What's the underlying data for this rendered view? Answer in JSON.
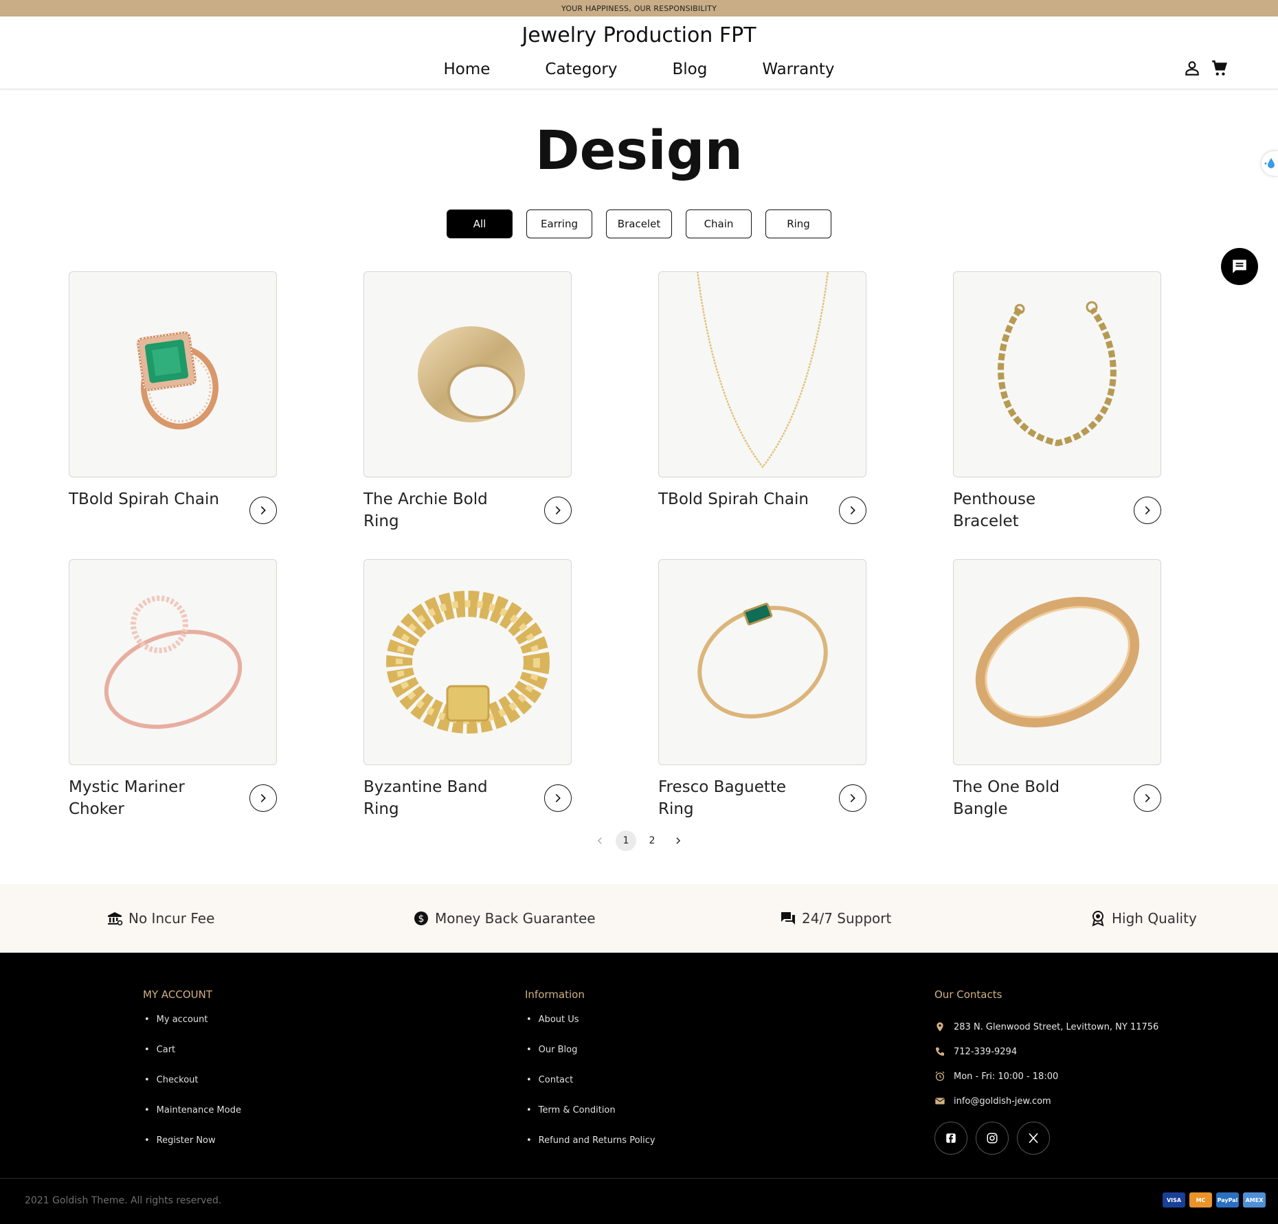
{
  "topbar": {
    "text": "YOUR HAPPINESS, OUR RESPONSIBILITY"
  },
  "header": {
    "brand": "Jewelry Production FPT",
    "nav": [
      "Home",
      "Category",
      "Blog",
      "Warranty"
    ],
    "icons": [
      "account-icon",
      "cart-icon"
    ]
  },
  "page": {
    "title": "Design"
  },
  "filters": [
    "All",
    "Earring",
    "Bracelet",
    "Chain",
    "Ring"
  ],
  "active_filter": "All",
  "products": [
    {
      "name": "TBold Spirah Chain",
      "image": "emerald-ring"
    },
    {
      "name": "The Archie Bold Ring",
      "image": "dome-ring"
    },
    {
      "name": "TBold Spirah Chain",
      "image": "chain-necklace"
    },
    {
      "name": "Penthouse Bracelet",
      "image": "chain-bracelet"
    },
    {
      "name": "Mystic Mariner Choker",
      "image": "circle-diamond-ring"
    },
    {
      "name": "Byzantine Band Ring",
      "image": "byzantine-ring"
    },
    {
      "name": "Fresco Baguette Ring",
      "image": "baguette-ring"
    },
    {
      "name": "The One Bold Bangle",
      "image": "bangle"
    }
  ],
  "pagination": {
    "pages": [
      "1",
      "2"
    ],
    "current": "1"
  },
  "features": [
    {
      "label": "No Incur Fee",
      "icon": "bank-icon"
    },
    {
      "label": "Money Back Guarantee",
      "icon": "dollar-circle-icon"
    },
    {
      "label": "24/7 Support",
      "icon": "chat-icon"
    },
    {
      "label": "High Quality",
      "icon": "badge-icon"
    }
  ],
  "footer": {
    "account": {
      "heading": "MY ACCOUNT",
      "links": [
        "My account",
        "Cart",
        "Checkout",
        "Maintenance Mode",
        "Register Now"
      ]
    },
    "information": {
      "heading": "Information",
      "links": [
        "About Us",
        "Our Blog",
        "Contact",
        "Term & Condition",
        "Refund and Returns Policy"
      ]
    },
    "contacts": {
      "heading": "Our Contacts",
      "address": "283 N. Glenwood Street, Levittown, NY 11756",
      "phone": "712-339-9294",
      "hours": "Mon - Fri: 10:00 - 18:00",
      "email": "info@goldish-jew.com"
    },
    "socials": [
      "facebook-icon",
      "instagram-icon",
      "x-icon"
    ],
    "copyright": "2021 Goldish Theme. All rights reserved.",
    "payments": [
      "VISA",
      "MC",
      "PayPal",
      "AMEX"
    ]
  },
  "colors": {
    "topbar": "#c8ad86",
    "accent": "#d2b184",
    "footer_bg": "#000000",
    "features_bg": "#fbf7f2"
  }
}
